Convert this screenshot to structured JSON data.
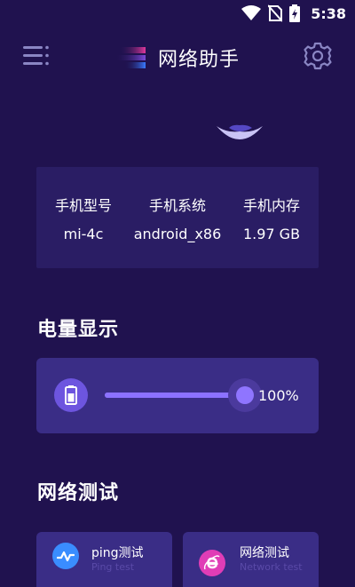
{
  "status_bar": {
    "time": "5:38",
    "icons": [
      "wifi-icon",
      "no-sim-icon",
      "battery-charging-icon"
    ]
  },
  "header": {
    "title": "网络助手",
    "menu_icon": "menu-icon",
    "settings_icon": "gear-icon"
  },
  "device_info": [
    {
      "label": "手机型号",
      "value": "mi-4c"
    },
    {
      "label": "手机系统",
      "value": "android_x86"
    },
    {
      "label": "手机内存",
      "value": "1.97 GB"
    }
  ],
  "battery_section": {
    "title": "电量显示",
    "level": 100,
    "level_text": "100%",
    "icon": "battery-icon"
  },
  "network_section": {
    "title": "网络测试",
    "tools": [
      {
        "title": "ping测试",
        "subtitle": "Ping test",
        "icon": "pulse-icon",
        "color": "#3a8dff"
      },
      {
        "title": "网络测试",
        "subtitle": "Network test",
        "icon": "ie-browser-icon",
        "color": "#e03db6"
      }
    ]
  },
  "colors": {
    "background": "#20124f",
    "card": "#3a2d86",
    "info_card": "#2a1d64",
    "accent": "#8c72ff"
  }
}
